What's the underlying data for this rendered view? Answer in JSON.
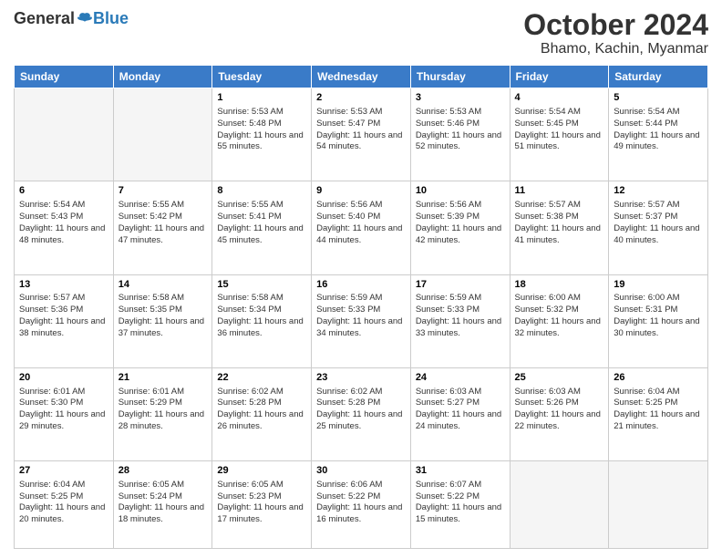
{
  "logo": {
    "general": "General",
    "blue": "Blue"
  },
  "title": "October 2024",
  "location": "Bhamo, Kachin, Myanmar",
  "days_header": [
    "Sunday",
    "Monday",
    "Tuesday",
    "Wednesday",
    "Thursday",
    "Friday",
    "Saturday"
  ],
  "weeks": [
    [
      {
        "num": "",
        "info": ""
      },
      {
        "num": "",
        "info": ""
      },
      {
        "num": "1",
        "info": "Sunrise: 5:53 AM\nSunset: 5:48 PM\nDaylight: 11 hours and 55 minutes."
      },
      {
        "num": "2",
        "info": "Sunrise: 5:53 AM\nSunset: 5:47 PM\nDaylight: 11 hours and 54 minutes."
      },
      {
        "num": "3",
        "info": "Sunrise: 5:53 AM\nSunset: 5:46 PM\nDaylight: 11 hours and 52 minutes."
      },
      {
        "num": "4",
        "info": "Sunrise: 5:54 AM\nSunset: 5:45 PM\nDaylight: 11 hours and 51 minutes."
      },
      {
        "num": "5",
        "info": "Sunrise: 5:54 AM\nSunset: 5:44 PM\nDaylight: 11 hours and 49 minutes."
      }
    ],
    [
      {
        "num": "6",
        "info": "Sunrise: 5:54 AM\nSunset: 5:43 PM\nDaylight: 11 hours and 48 minutes."
      },
      {
        "num": "7",
        "info": "Sunrise: 5:55 AM\nSunset: 5:42 PM\nDaylight: 11 hours and 47 minutes."
      },
      {
        "num": "8",
        "info": "Sunrise: 5:55 AM\nSunset: 5:41 PM\nDaylight: 11 hours and 45 minutes."
      },
      {
        "num": "9",
        "info": "Sunrise: 5:56 AM\nSunset: 5:40 PM\nDaylight: 11 hours and 44 minutes."
      },
      {
        "num": "10",
        "info": "Sunrise: 5:56 AM\nSunset: 5:39 PM\nDaylight: 11 hours and 42 minutes."
      },
      {
        "num": "11",
        "info": "Sunrise: 5:57 AM\nSunset: 5:38 PM\nDaylight: 11 hours and 41 minutes."
      },
      {
        "num": "12",
        "info": "Sunrise: 5:57 AM\nSunset: 5:37 PM\nDaylight: 11 hours and 40 minutes."
      }
    ],
    [
      {
        "num": "13",
        "info": "Sunrise: 5:57 AM\nSunset: 5:36 PM\nDaylight: 11 hours and 38 minutes."
      },
      {
        "num": "14",
        "info": "Sunrise: 5:58 AM\nSunset: 5:35 PM\nDaylight: 11 hours and 37 minutes."
      },
      {
        "num": "15",
        "info": "Sunrise: 5:58 AM\nSunset: 5:34 PM\nDaylight: 11 hours and 36 minutes."
      },
      {
        "num": "16",
        "info": "Sunrise: 5:59 AM\nSunset: 5:33 PM\nDaylight: 11 hours and 34 minutes."
      },
      {
        "num": "17",
        "info": "Sunrise: 5:59 AM\nSunset: 5:33 PM\nDaylight: 11 hours and 33 minutes."
      },
      {
        "num": "18",
        "info": "Sunrise: 6:00 AM\nSunset: 5:32 PM\nDaylight: 11 hours and 32 minutes."
      },
      {
        "num": "19",
        "info": "Sunrise: 6:00 AM\nSunset: 5:31 PM\nDaylight: 11 hours and 30 minutes."
      }
    ],
    [
      {
        "num": "20",
        "info": "Sunrise: 6:01 AM\nSunset: 5:30 PM\nDaylight: 11 hours and 29 minutes."
      },
      {
        "num": "21",
        "info": "Sunrise: 6:01 AM\nSunset: 5:29 PM\nDaylight: 11 hours and 28 minutes."
      },
      {
        "num": "22",
        "info": "Sunrise: 6:02 AM\nSunset: 5:28 PM\nDaylight: 11 hours and 26 minutes."
      },
      {
        "num": "23",
        "info": "Sunrise: 6:02 AM\nSunset: 5:28 PM\nDaylight: 11 hours and 25 minutes."
      },
      {
        "num": "24",
        "info": "Sunrise: 6:03 AM\nSunset: 5:27 PM\nDaylight: 11 hours and 24 minutes."
      },
      {
        "num": "25",
        "info": "Sunrise: 6:03 AM\nSunset: 5:26 PM\nDaylight: 11 hours and 22 minutes."
      },
      {
        "num": "26",
        "info": "Sunrise: 6:04 AM\nSunset: 5:25 PM\nDaylight: 11 hours and 21 minutes."
      }
    ],
    [
      {
        "num": "27",
        "info": "Sunrise: 6:04 AM\nSunset: 5:25 PM\nDaylight: 11 hours and 20 minutes."
      },
      {
        "num": "28",
        "info": "Sunrise: 6:05 AM\nSunset: 5:24 PM\nDaylight: 11 hours and 18 minutes."
      },
      {
        "num": "29",
        "info": "Sunrise: 6:05 AM\nSunset: 5:23 PM\nDaylight: 11 hours and 17 minutes."
      },
      {
        "num": "30",
        "info": "Sunrise: 6:06 AM\nSunset: 5:22 PM\nDaylight: 11 hours and 16 minutes."
      },
      {
        "num": "31",
        "info": "Sunrise: 6:07 AM\nSunset: 5:22 PM\nDaylight: 11 hours and 15 minutes."
      },
      {
        "num": "",
        "info": ""
      },
      {
        "num": "",
        "info": ""
      }
    ]
  ]
}
